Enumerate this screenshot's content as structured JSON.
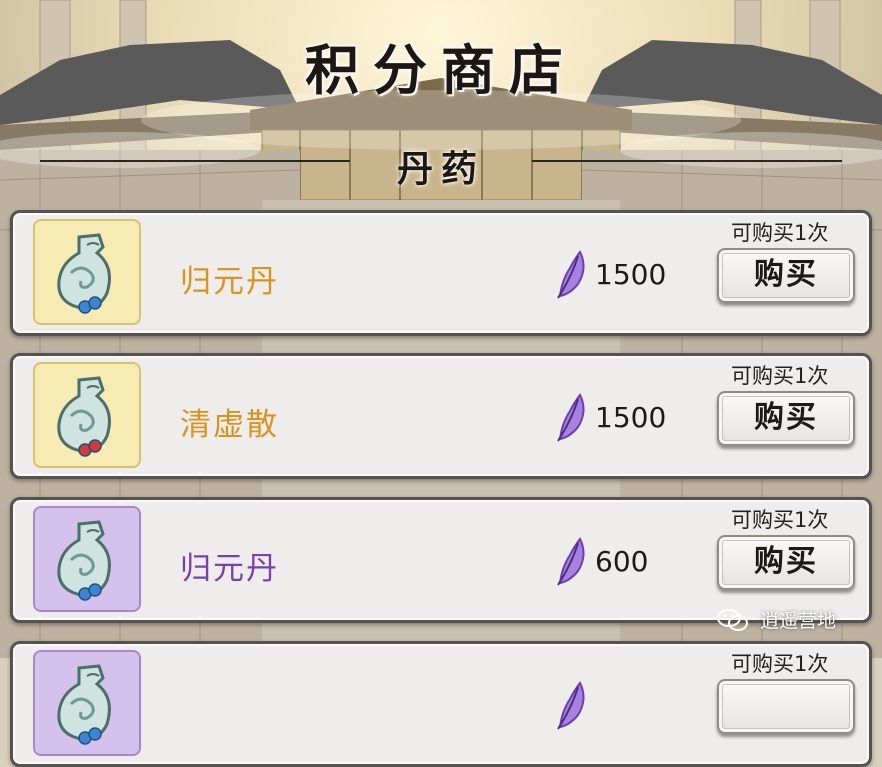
{
  "header": {
    "title": "积分商店",
    "section_title": "丹药"
  },
  "colors": {
    "rarity_yellow": "#f7ebb4",
    "rarity_purple": "#d5c2ec",
    "name_gold": "#d8941e",
    "name_purple": "#7a3fae",
    "currency_purple": "#9b6fd6"
  },
  "currency_icon": "purple-feather-icon",
  "items": [
    {
      "name": "归元丹",
      "price": "1500",
      "limit": "可购买1次",
      "buy_label": "购买",
      "rarity": "yellow",
      "icon": "vase-pill-icon",
      "bead_color": "#3a86d4"
    },
    {
      "name": "清虚散",
      "price": "1500",
      "limit": "可购买1次",
      "buy_label": "购买",
      "rarity": "yellow",
      "icon": "vase-pill-icon",
      "bead_color": "#d43a3a"
    },
    {
      "name": "归元丹",
      "price": "600",
      "limit": "可购买1次",
      "buy_label": "购买",
      "rarity": "purple",
      "icon": "vase-pill-icon",
      "bead_color": "#3a86d4"
    },
    {
      "name": "",
      "price": "",
      "limit": "可购买1次",
      "buy_label": "",
      "rarity": "purple",
      "icon": "vase-pill-icon",
      "bead_color": ""
    }
  ],
  "watermark": {
    "text": "逍遥营地",
    "icon": "wechat-icon"
  }
}
